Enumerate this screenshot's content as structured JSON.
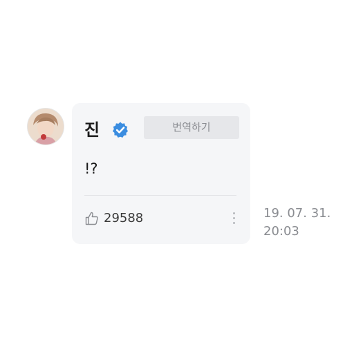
{
  "comment": {
    "author_name": "진",
    "verified_icon": "verified-badge-icon",
    "translate_label": "번역하기",
    "message": "!?",
    "like_icon": "thumbs-up-icon",
    "like_count": "29588",
    "more_icon": "more-vertical-icon",
    "date": "19. 07. 31.",
    "time": "20:03"
  },
  "colors": {
    "bubble_background": "#f5f6f8",
    "verified_blue": "#3b8de0",
    "translate_button": "#e6e7ea",
    "muted_text": "#8a8c91"
  }
}
